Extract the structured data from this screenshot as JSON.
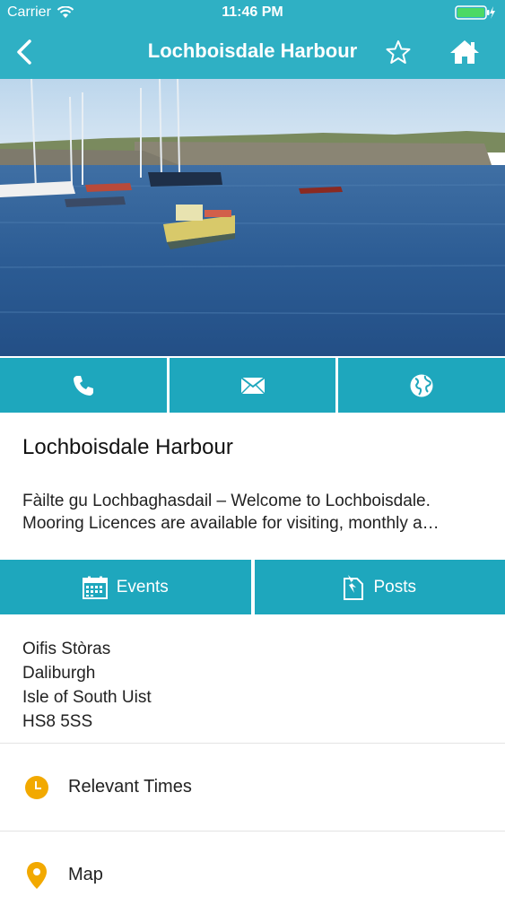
{
  "status_bar": {
    "carrier": "Carrier",
    "time": "11:46 PM"
  },
  "nav": {
    "title": "Lochboisdale Harbour"
  },
  "place": {
    "title": "Lochboisdale Harbour",
    "description_lines": [
      "Fàilte gu Lochbaghasdail – Welcome to Lochboisdale.",
      "Mooring Licences are available for visiting, monthly a…"
    ]
  },
  "tabs": {
    "events": "Events",
    "posts": "Posts"
  },
  "address": [
    "Oifis Stòras",
    "Daliburgh",
    "Isle of South Uist",
    "HS8 5SS"
  ],
  "rows": {
    "relevant_times": "Relevant Times",
    "map": "Map"
  },
  "colors": {
    "header": "#2fb0c4",
    "button": "#1ea7bd",
    "accent_icon": "#f2a900"
  },
  "icons": [
    "back-icon",
    "star-icon",
    "home-icon",
    "phone-icon",
    "mail-icon",
    "globe-icon",
    "calendar-icon",
    "post-icon",
    "clock-icon",
    "map-pin-icon"
  ]
}
